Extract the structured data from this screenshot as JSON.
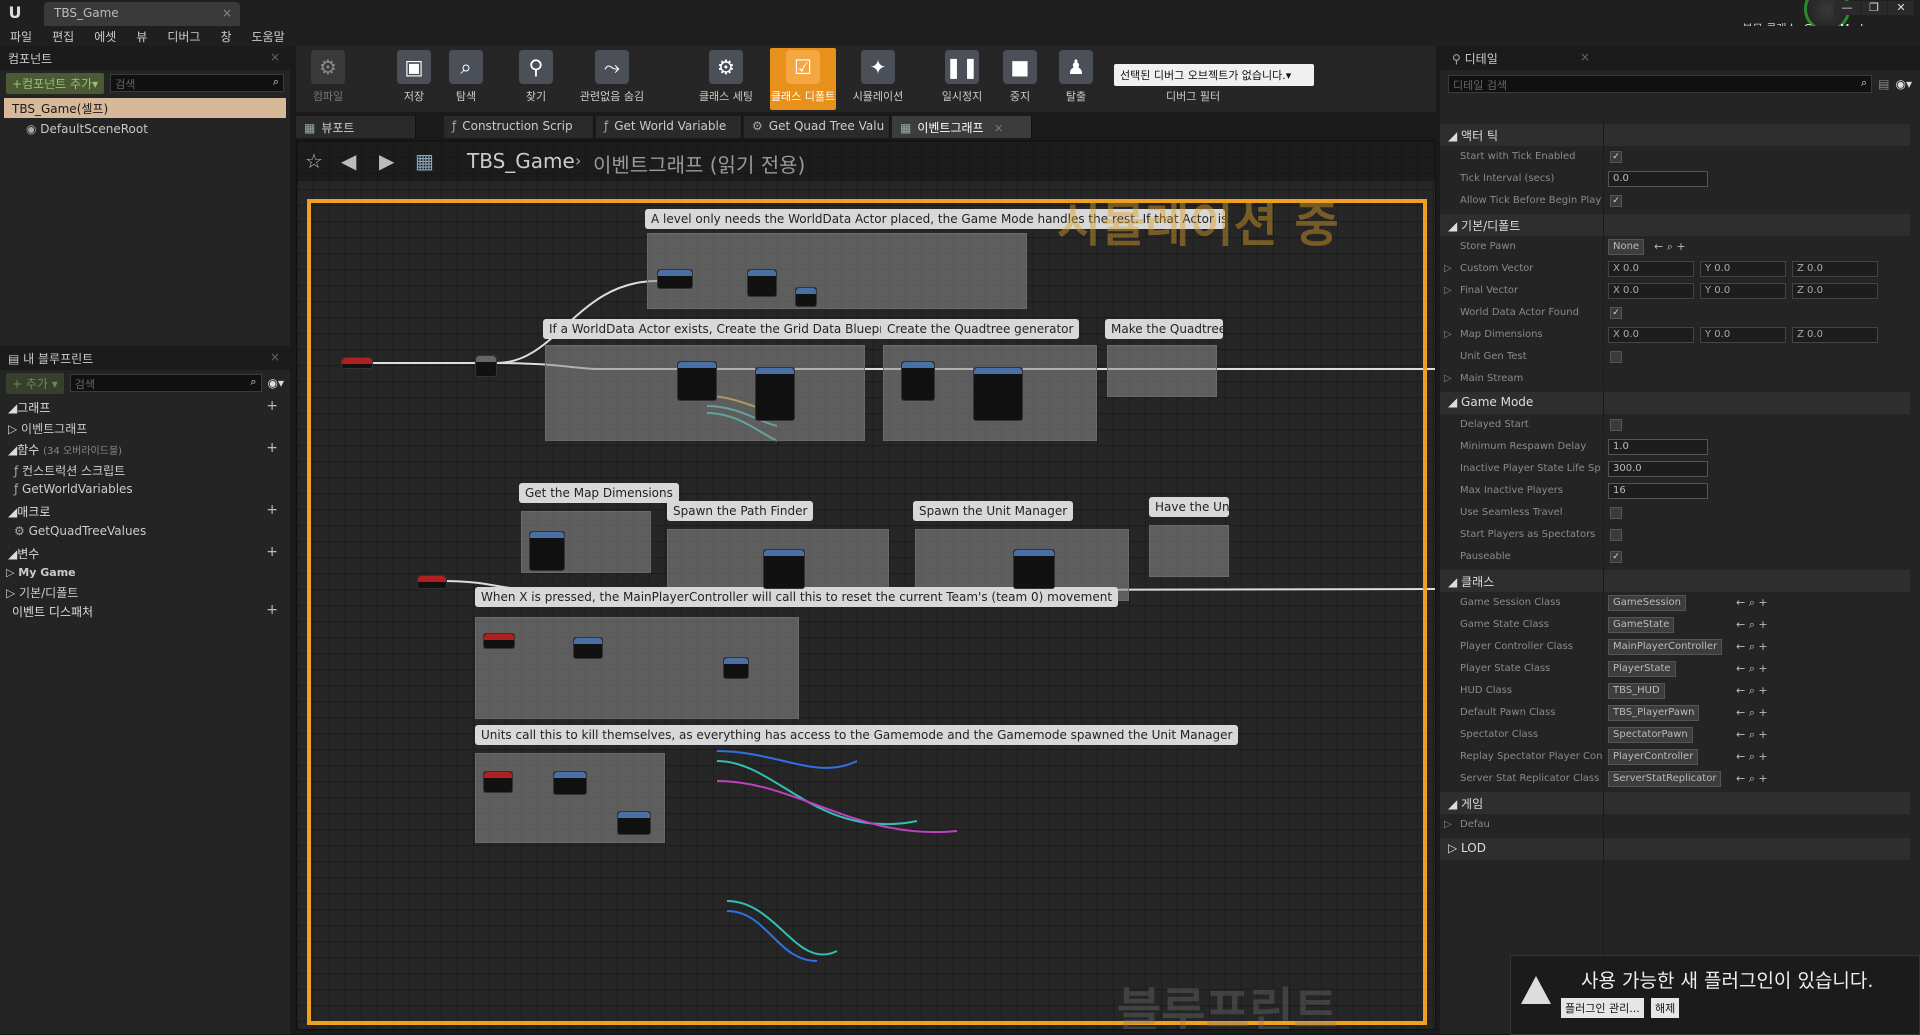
{
  "title_bar": {
    "doc_tab": "TBS_Game",
    "mode_top": "부모 클래스:",
    "mode": "Game Mode"
  },
  "menu": [
    "파일",
    "편집",
    "에셋",
    "뷰",
    "디버그",
    "창",
    "도움말"
  ],
  "components": {
    "tab": "컴포넌트",
    "add_button": "+컴포넌트 추가▾",
    "search_placeholder": "검색",
    "items": [
      "TBS_Game(셀프)",
      "DefaultSceneRoot"
    ]
  },
  "my_blueprint": {
    "tab": "내 블루프린트",
    "search_placeholder": "검색",
    "sections": [
      {
        "label": "그래프"
      },
      {
        "label": "함수",
        "note": "(34 오버라이드블)"
      },
      {
        "label": "매크로"
      },
      {
        "label": "변수"
      },
      {
        "label": "이벤트 디스패처"
      }
    ],
    "graph_items": [
      "이벤트그래프"
    ],
    "function_items": [
      "컨스트럭션 스크립트",
      "GetWorldVariables"
    ],
    "macro_items": [
      "GetQuadTreeValues"
    ],
    "variable_groups": [
      "My Game",
      "기본/디폴트"
    ]
  },
  "toolbar": {
    "buttons": [
      {
        "label": "컴파일",
        "icon": "compile-icon"
      },
      {
        "label": "저장",
        "icon": "save-icon"
      },
      {
        "label": "탐색",
        "icon": "browse-icon"
      },
      {
        "label": "찾기",
        "icon": "find-icon"
      },
      {
        "label": "관련없음 숨김",
        "icon": "hide-unrelated-icon"
      },
      {
        "label": "클래스 세팅",
        "icon": "class-settings-icon"
      },
      {
        "label": "클래스 디폴트",
        "icon": "class-defaults-icon"
      },
      {
        "label": "시뮬레이션",
        "icon": "simulation-icon"
      },
      {
        "label": "일시정지",
        "icon": "pause-icon"
      },
      {
        "label": "중지",
        "icon": "stop-icon"
      },
      {
        "label": "탈출",
        "icon": "eject-icon"
      }
    ],
    "debug_select": "선택된 디버그 오브젝트가 없습니다.▾",
    "debug_label": "디버그 필터"
  },
  "graph_tabs": [
    "뷰포트",
    "Construction Scrip",
    "Get World Variable",
    "Get Quad Tree Valu",
    "이벤트그래프"
  ],
  "graph": {
    "breadcrumb_root": "TBS_Game",
    "breadcrumb_sub": "이벤트그래프  (읽기 전용)",
    "sim_watermark": "시뮬레이션 중",
    "bp_watermark": "블루프린트",
    "comments": [
      "A level only needs the WorldData Actor placed, the Game Mode handles the rest. If that Actor isn't available, we fail out of tha",
      "If a WorldData Actor exists, Create the Grid Data Blueprint",
      "Create the Quadtree generator",
      "Make the Quadtree Ge",
      "Get the Map Dimensions",
      "Spawn the Path Finder",
      "Spawn the Unit Manager",
      "Have the Uni",
      "When X is pressed, the MainPlayerController will call this to reset the current Team's (team 0) movement",
      "Units call this to kill themselves, as everything has access to the Gamemode and the Gamemode spawned the Unit Manager"
    ]
  },
  "details": {
    "tab": "디테일",
    "search_placeholder": "디테일 검색",
    "categories": [
      {
        "name": "액터 틱",
        "props": [
          {
            "name": "Start with Tick Enabled",
            "type": "check",
            "value": "✓"
          },
          {
            "name": "Tick Interval (secs)",
            "type": "num",
            "value": "0.0"
          },
          {
            "name": "Allow Tick Before Begin Play",
            "type": "check",
            "value": "✓"
          }
        ]
      },
      {
        "name": "기본/디폴트",
        "props": [
          {
            "name": "Store Pawn",
            "type": "select",
            "value": "None"
          },
          {
            "name": "Custom Vector",
            "type": "vec",
            "x": "X 0.0",
            "y": "Y 0.0",
            "z": "Z 0.0"
          },
          {
            "name": "Final Vector",
            "type": "vec",
            "x": "X 0.0",
            "y": "Y 0.0",
            "z": "Z 0.0"
          },
          {
            "name": "World Data Actor Found",
            "type": "check",
            "value": "✓"
          },
          {
            "name": "Map Dimensions",
            "type": "vec",
            "x": "X 0.0",
            "y": "Y 0.0",
            "z": "Z 0.0"
          },
          {
            "name": "Unit Gen Test",
            "type": "check",
            "value": ""
          },
          {
            "name": "Main Stream",
            "type": "none"
          }
        ]
      },
      {
        "name": "Game Mode",
        "props": [
          {
            "name": "Delayed Start",
            "type": "check",
            "value": ""
          },
          {
            "name": "Minimum Respawn Delay",
            "type": "num",
            "value": "1.0"
          },
          {
            "name": "Inactive Player State Life Sp",
            "type": "num",
            "value": "300.0"
          },
          {
            "name": "Max Inactive Players",
            "type": "num",
            "value": "16"
          },
          {
            "name": "Use Seamless Travel",
            "type": "check",
            "value": ""
          },
          {
            "name": "Start Players as Spectators",
            "type": "check",
            "value": ""
          },
          {
            "name": "Pauseable",
            "type": "check",
            "value": "✓"
          }
        ]
      },
      {
        "name": "클래스",
        "props": [
          {
            "name": "Game Session Class",
            "type": "class",
            "value": "GameSession"
          },
          {
            "name": "Game State Class",
            "type": "class",
            "value": "GameState"
          },
          {
            "name": "Player Controller Class",
            "type": "class",
            "value": "MainPlayerController"
          },
          {
            "name": "Player State Class",
            "type": "class",
            "value": "PlayerState"
          },
          {
            "name": "HUD Class",
            "type": "class",
            "value": "TBS_HUD"
          },
          {
            "name": "Default Pawn Class",
            "type": "class",
            "value": "TBS_PlayerPawn"
          },
          {
            "name": "Spectator Class",
            "type": "class",
            "value": "SpectatorPawn"
          },
          {
            "name": "Replay Spectator Player Con",
            "type": "class",
            "value": "PlayerController"
          },
          {
            "name": "Server Stat Replicator Class",
            "type": "class",
            "value": "ServerStatReplicator"
          }
        ]
      },
      {
        "name": "게임",
        "props": [
          {
            "name": "Defau",
            "type": "none"
          }
        ]
      },
      {
        "name": "LOD",
        "props": []
      }
    ]
  },
  "notification": {
    "message": "사용 가능한 새 플러그인이 있습니다.",
    "manage": "플러그인 관리...",
    "dismiss": "해제"
  }
}
